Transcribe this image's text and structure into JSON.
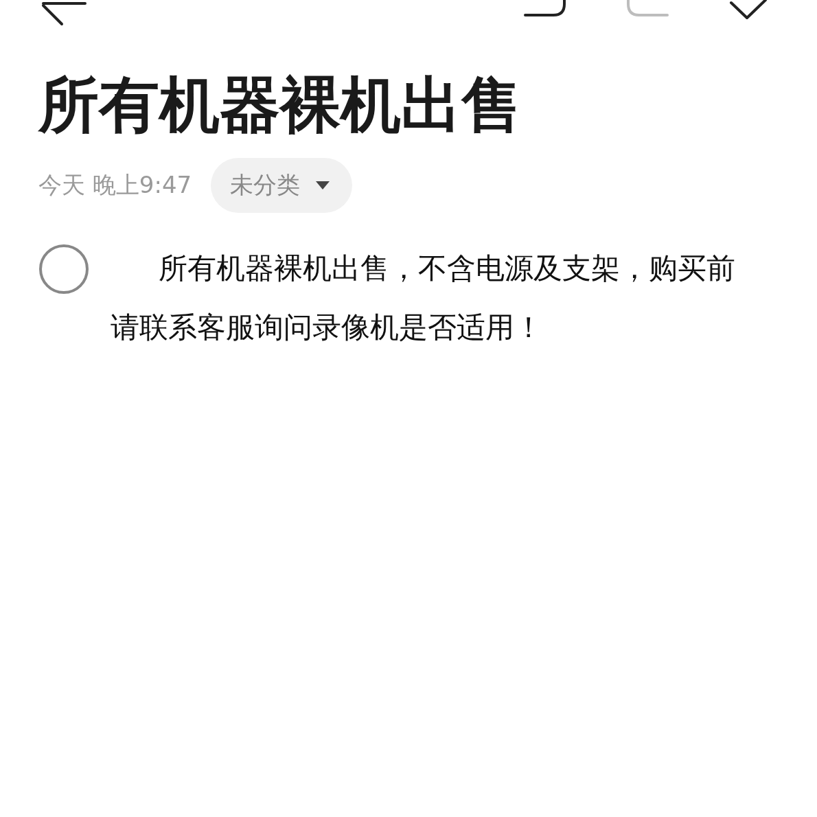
{
  "toolbar": {
    "undo": {
      "disabled": false
    },
    "redo": {
      "disabled": true
    }
  },
  "title": "所有机器裸机出售",
  "meta": {
    "date": "今天 晚上9:47",
    "category": "未分类"
  },
  "checklist": [
    {
      "checked": false,
      "text": "所有机器裸机出售，不含电源及支架，购买前请联系客服询问录像机是否适用！"
    }
  ]
}
